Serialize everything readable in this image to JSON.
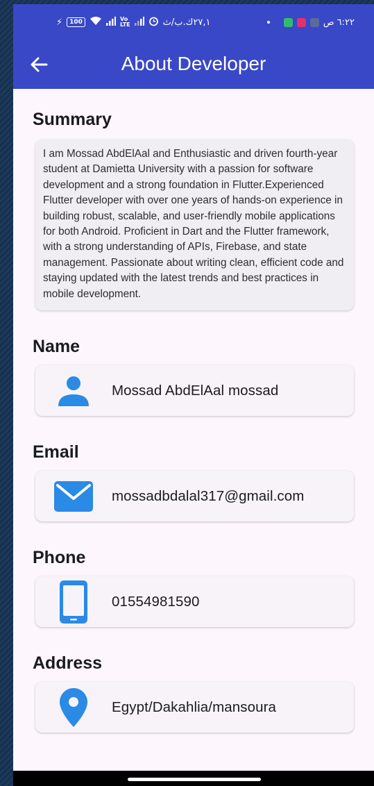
{
  "status_bar": {
    "time": "٦:٢٢ ص",
    "speed": "٢٧,١ك.ب/ث",
    "battery": "100"
  },
  "app_bar": {
    "title": "About Developer",
    "back_icon": "arrow-left-icon"
  },
  "summary": {
    "title": "Summary",
    "text": "I am Mossad AbdElAal and Enthusiastic and driven fourth-year student at Damietta University with a passion for software development and a strong foundation in Flutter.Experienced Flutter developer with over one years of hands-on experience in building robust, scalable, and user-friendly mobile applications for both Android. Proficient in Dart and the Flutter framework, with a strong understanding of APIs, Firebase, and state management. Passionate about writing clean, efficient code and staying updated with the latest trends and best practices in mobile development."
  },
  "fields": {
    "name": {
      "title": "Name",
      "value": "Mossad AbdElAal mossad",
      "icon": "person-icon"
    },
    "email": {
      "title": "Email",
      "value": "mossadbdalal317@gmail.com",
      "icon": "email-icon"
    },
    "phone": {
      "title": "Phone",
      "value": "01554981590",
      "icon": "smartphone-icon"
    },
    "address": {
      "title": "Address",
      "value": "Egypt/Dakahlia/mansoura",
      "icon": "location-pin-icon"
    }
  },
  "colors": {
    "app_bar": "#3948c6",
    "icon_blue": "#2a8ae6",
    "background": "#fdf7fd"
  }
}
